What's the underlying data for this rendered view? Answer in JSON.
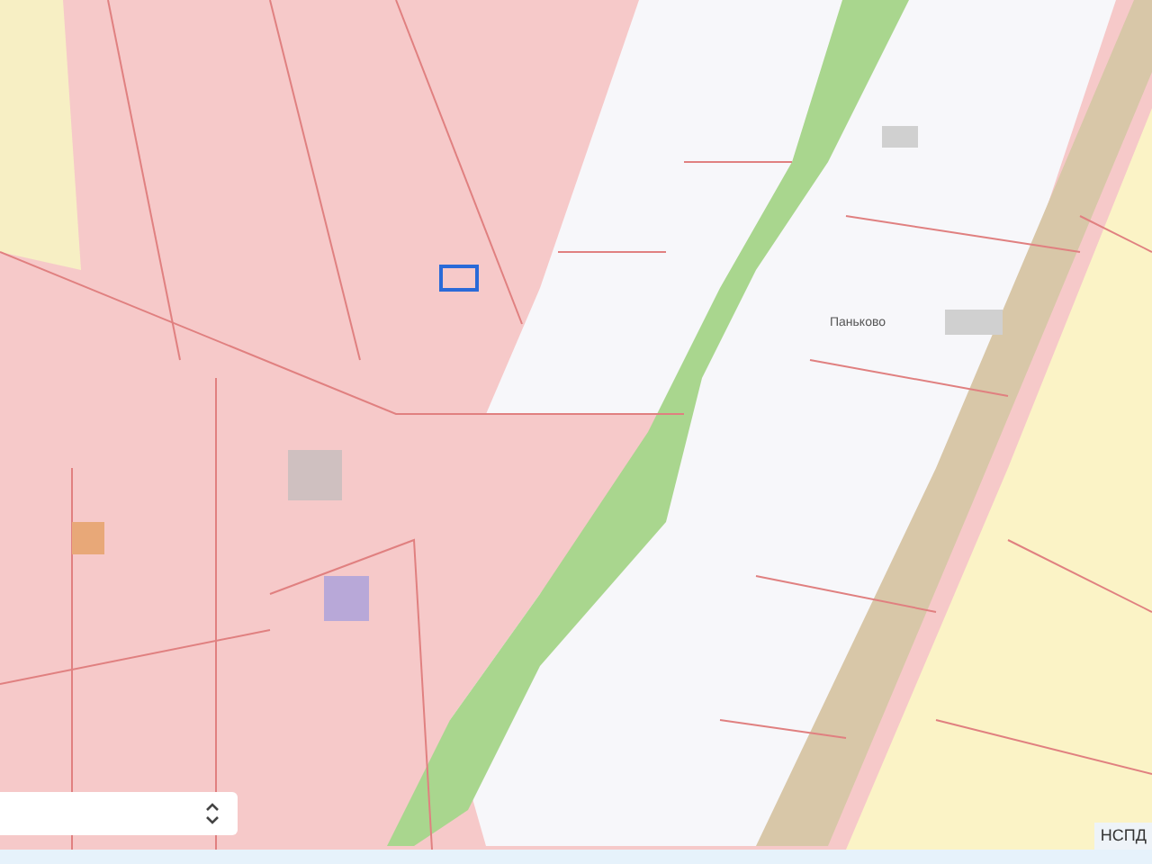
{
  "map": {
    "place_label": "Паньково",
    "attribution": "НСПД"
  }
}
